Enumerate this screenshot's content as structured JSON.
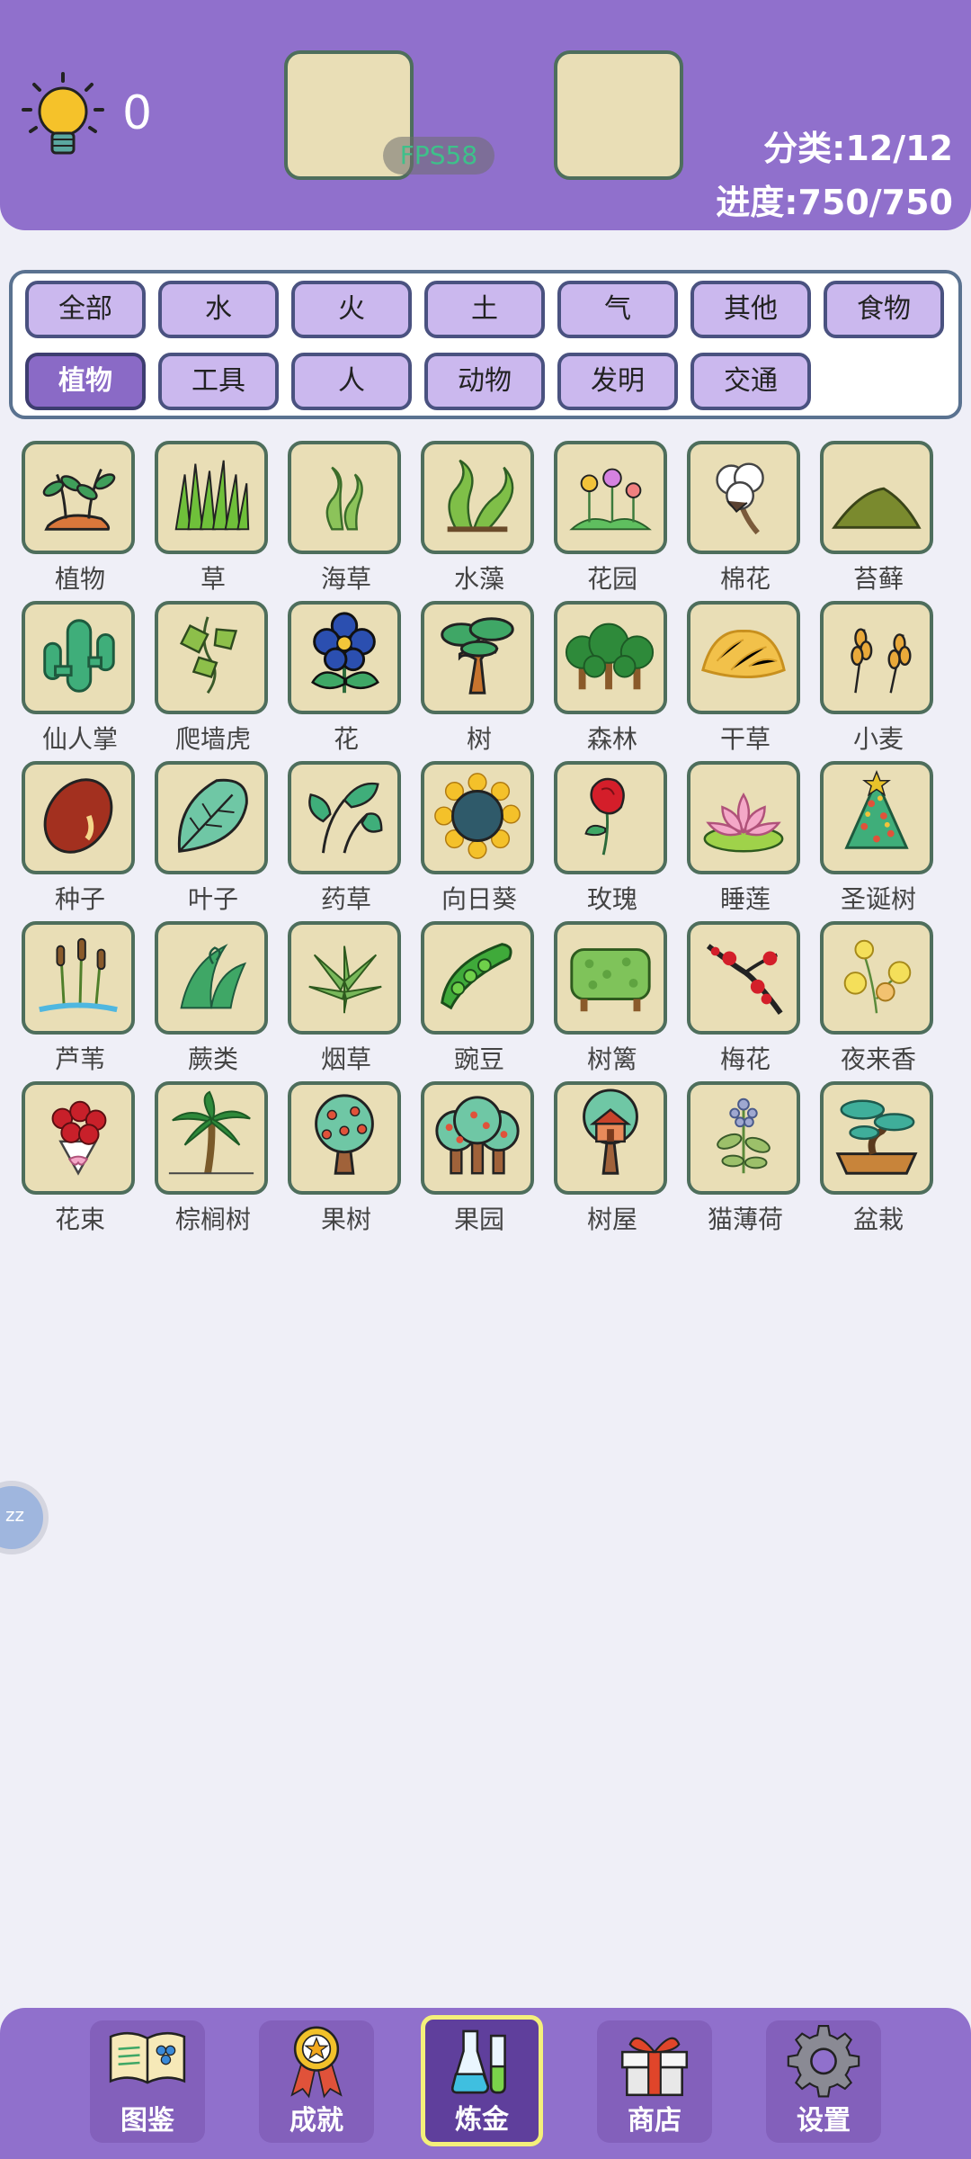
{
  "header": {
    "hint_count": "0",
    "fps_label": "FPS58",
    "category_progress": "分类:12/12",
    "overall_progress": "进度:750/750"
  },
  "filters": [
    {
      "label": "全部",
      "active": false
    },
    {
      "label": "水",
      "active": false
    },
    {
      "label": "火",
      "active": false
    },
    {
      "label": "土",
      "active": false
    },
    {
      "label": "气",
      "active": false
    },
    {
      "label": "其他",
      "active": false
    },
    {
      "label": "食物",
      "active": false
    },
    {
      "label": "植物",
      "active": true
    },
    {
      "label": "工具",
      "active": false
    },
    {
      "label": "人",
      "active": false
    },
    {
      "label": "动物",
      "active": false
    },
    {
      "label": "发明",
      "active": false
    },
    {
      "label": "交通",
      "active": false
    }
  ],
  "elements": [
    {
      "name": "植物",
      "icon": "plant-icon"
    },
    {
      "name": "草",
      "icon": "grass-icon"
    },
    {
      "name": "海草",
      "icon": "seaweed-icon"
    },
    {
      "name": "水藻",
      "icon": "algae-icon"
    },
    {
      "name": "花园",
      "icon": "garden-icon"
    },
    {
      "name": "棉花",
      "icon": "cotton-icon"
    },
    {
      "name": "苔藓",
      "icon": "moss-icon"
    },
    {
      "name": "仙人掌",
      "icon": "cactus-icon"
    },
    {
      "name": "爬墙虎",
      "icon": "ivy-icon"
    },
    {
      "name": "花",
      "icon": "flower-icon"
    },
    {
      "name": "树",
      "icon": "tree-icon"
    },
    {
      "name": "森林",
      "icon": "forest-icon"
    },
    {
      "name": "干草",
      "icon": "hay-icon"
    },
    {
      "name": "小麦",
      "icon": "wheat-icon"
    },
    {
      "name": "种子",
      "icon": "seed-icon"
    },
    {
      "name": "叶子",
      "icon": "leaf-icon"
    },
    {
      "name": "药草",
      "icon": "herb-icon"
    },
    {
      "name": "向日葵",
      "icon": "sunflower-icon"
    },
    {
      "name": "玫瑰",
      "icon": "rose-icon"
    },
    {
      "name": "睡莲",
      "icon": "water-lily-icon"
    },
    {
      "name": "圣诞树",
      "icon": "christmas-tree-icon"
    },
    {
      "name": "芦苇",
      "icon": "reed-icon"
    },
    {
      "name": "蕨类",
      "icon": "fern-icon"
    },
    {
      "name": "烟草",
      "icon": "tobacco-icon"
    },
    {
      "name": "豌豆",
      "icon": "pea-icon"
    },
    {
      "name": "树篱",
      "icon": "hedge-icon"
    },
    {
      "name": "梅花",
      "icon": "plum-blossom-icon"
    },
    {
      "name": "夜来香",
      "icon": "night-jasmine-icon"
    },
    {
      "name": "花束",
      "icon": "bouquet-icon"
    },
    {
      "name": "棕榈树",
      "icon": "palm-tree-icon"
    },
    {
      "name": "果树",
      "icon": "fruit-tree-icon"
    },
    {
      "name": "果园",
      "icon": "orchard-icon"
    },
    {
      "name": "树屋",
      "icon": "treehouse-icon"
    },
    {
      "name": "猫薄荷",
      "icon": "catnip-icon"
    },
    {
      "name": "盆栽",
      "icon": "bonsai-icon"
    }
  ],
  "side_button": {
    "label": "zz"
  },
  "bottom_nav": [
    {
      "label": "图鉴",
      "icon": "encyclopedia-book-icon",
      "active": false
    },
    {
      "label": "成就",
      "icon": "medal-icon",
      "active": false
    },
    {
      "label": "炼金",
      "icon": "flask-icon",
      "active": true
    },
    {
      "label": "商店",
      "icon": "gift-box-icon",
      "active": false
    },
    {
      "label": "设置",
      "icon": "gear-icon",
      "active": false
    }
  ]
}
